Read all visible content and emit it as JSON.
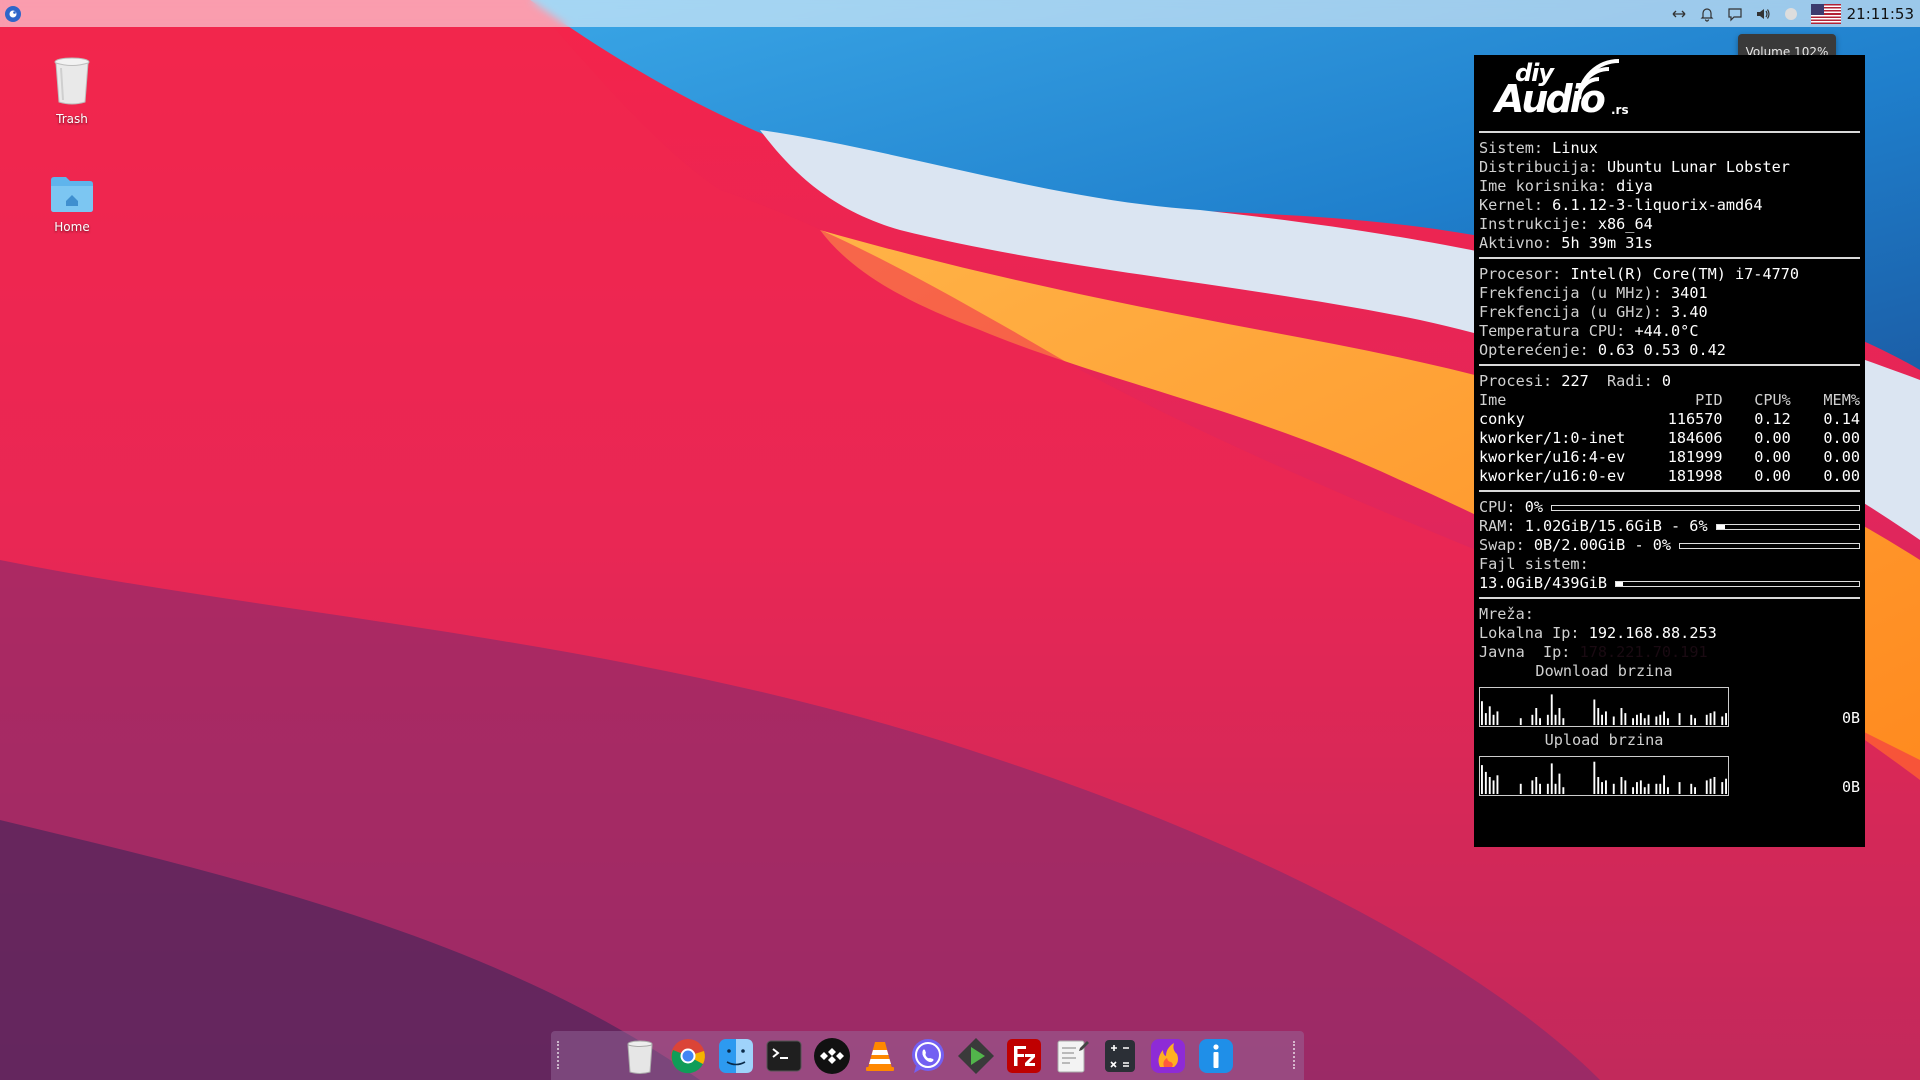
{
  "desktop": {
    "icons": [
      {
        "label": "Trash",
        "icon": "trash-icon"
      },
      {
        "label": "Home",
        "icon": "home-folder-icon"
      }
    ]
  },
  "top_panel": {
    "clock": "21:11:53",
    "tray_icons": [
      "network-icon",
      "notification-bell-icon",
      "chat-icon",
      "volume-icon",
      "night-mode-icon",
      "us-flag-icon"
    ],
    "volume_tooltip": "Volume 102%"
  },
  "conky": {
    "logo": {
      "diy": "diy",
      "audio": "Audio",
      "suffix": ".rs"
    },
    "system": [
      {
        "label": "Sistem: ",
        "value": "Linux"
      },
      {
        "label": "Distribucija: ",
        "value": "Ubuntu Lunar Lobster"
      },
      {
        "label": "Ime korisnika: ",
        "value": "diya"
      },
      {
        "label": "Kernel: ",
        "value": "6.1.12-3-liquorix-amd64"
      },
      {
        "label": "Instrukcije: ",
        "value": "x86_64"
      },
      {
        "label": "Aktivno: ",
        "value": "5h 39m 31s"
      }
    ],
    "cpu_info": [
      {
        "label": "Procesor: ",
        "value": "Intel(R) Core(TM) i7-4770"
      },
      {
        "label": "Frekfencija (u MHz): ",
        "value": "3401"
      },
      {
        "label": "Frekfencija (u GHz): ",
        "value": "3.40"
      },
      {
        "label": "Temperatura CPU: ",
        "value": "+44.0°C"
      },
      {
        "label": "Opterećenje: ",
        "value": "0.63 0.53 0.42"
      }
    ],
    "processes": {
      "summary_label": "Procesi: ",
      "summary_value": "227",
      "running_label": "Radi: ",
      "running_value": "0",
      "headers": [
        "Ime",
        "PID",
        "CPU%",
        "MEM%"
      ],
      "rows": [
        [
          "conky",
          "116570",
          "0.12",
          "0.14"
        ],
        [
          "kworker/1:0-inet",
          "184606",
          "0.00",
          "0.00"
        ],
        [
          "kworker/u16:4-ev",
          "181999",
          "0.00",
          "0.00"
        ],
        [
          "kworker/u16:0-ev",
          "181998",
          "0.00",
          "0.00"
        ]
      ]
    },
    "usage": {
      "cpu_label": "CPU: ",
      "cpu_value": "0%",
      "cpu_fraction": 0.0,
      "ram_label": "RAM: ",
      "ram_value": "1.02GiB/15.6GiB - 6%",
      "ram_fraction": 0.06,
      "swap_label": "Swap: ",
      "swap_value": "0B/2.00GiB - 0%",
      "swap_fraction": 0.0,
      "fs_label": "Fajl sistem:",
      "fs_value": "13.0GiB/439GiB",
      "fs_fraction": 0.03
    },
    "network": {
      "title": "Mreža:",
      "local_label": "Lokalna Ip: ",
      "local_value": "192.168.88.253",
      "public_label": "Javna  Ip: ",
      "public_value": "178.221.70.191",
      "download_title": "Download brzina",
      "download_value": "0B",
      "upload_title": "Upload brzina",
      "upload_value": "0B",
      "download_graph": [
        0.7,
        0.35,
        0.55,
        0.3,
        0.4,
        0,
        0,
        0,
        0,
        0,
        0.2,
        0,
        0,
        0.3,
        0.5,
        0.2,
        0,
        0.3,
        0.9,
        0.3,
        0.5,
        0.2,
        0,
        0,
        0,
        0,
        0,
        0,
        0,
        0.75,
        0.5,
        0.3,
        0.4,
        0,
        0.25,
        0,
        0.5,
        0.35,
        0,
        0.2,
        0.3,
        0.35,
        0.2,
        0.3,
        0,
        0.25,
        0.3,
        0.4,
        0.2,
        0,
        0,
        0.35,
        0,
        0,
        0.3,
        0.2,
        0,
        0,
        0.3,
        0.35,
        0.4,
        0,
        0.25,
        0.35
      ],
      "upload_graph": [
        0.85,
        0.65,
        0.5,
        0.4,
        0.55,
        0,
        0,
        0,
        0,
        0,
        0.3,
        0,
        0,
        0.4,
        0.5,
        0.3,
        0,
        0.3,
        0.9,
        0.3,
        0.6,
        0.2,
        0,
        0,
        0,
        0,
        0,
        0,
        0,
        0.95,
        0.5,
        0.35,
        0.4,
        0,
        0.3,
        0,
        0.5,
        0.4,
        0,
        0.2,
        0.35,
        0.4,
        0.2,
        0.3,
        0,
        0.3,
        0.3,
        0.55,
        0.2,
        0,
        0,
        0.35,
        0,
        0,
        0.3,
        0.2,
        0,
        0,
        0.4,
        0.45,
        0.5,
        0,
        0.35,
        0.45
      ]
    }
  },
  "dock": {
    "items": [
      {
        "name": "trash",
        "icon": "trash-icon"
      },
      {
        "name": "chrome",
        "icon": "chrome-icon"
      },
      {
        "name": "finder",
        "icon": "finder-icon"
      },
      {
        "name": "terminal",
        "icon": "terminal-icon"
      },
      {
        "name": "tidal",
        "icon": "tidal-icon"
      },
      {
        "name": "vlc",
        "icon": "vlc-icon"
      },
      {
        "name": "viber",
        "icon": "viber-icon"
      },
      {
        "name": "emby",
        "icon": "play-icon"
      },
      {
        "name": "filezilla",
        "icon": "filezilla-icon"
      },
      {
        "name": "text-editor",
        "icon": "text-editor-icon"
      },
      {
        "name": "calculator",
        "icon": "calculator-icon"
      },
      {
        "name": "flame",
        "icon": "flame-icon"
      },
      {
        "name": "info",
        "icon": "info-icon"
      }
    ]
  },
  "colors": {
    "conky_bg": "#000000",
    "panel_bg": "#ffffff",
    "accent_blue": "#2f66c9"
  }
}
